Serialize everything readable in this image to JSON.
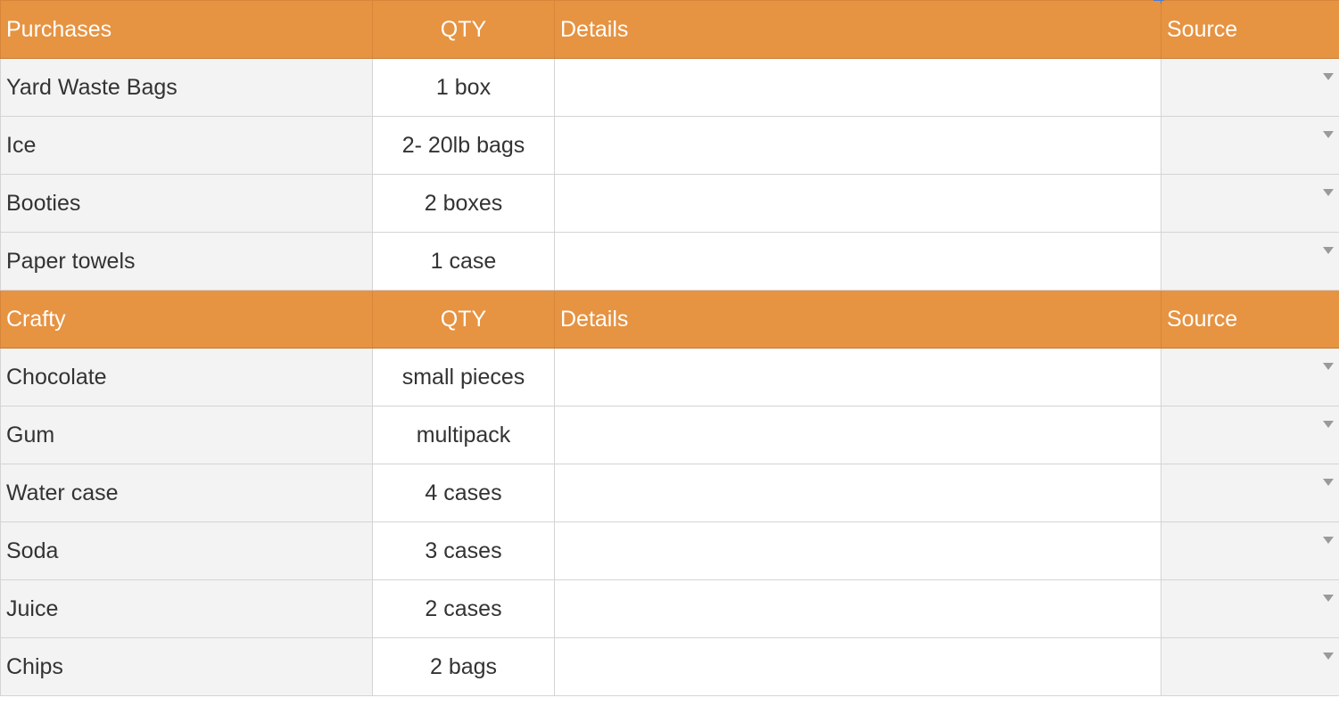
{
  "sections": [
    {
      "header": {
        "item": "Purchases",
        "qty": "QTY",
        "details": "Details",
        "source": "Source"
      },
      "rows": [
        {
          "item": "Yard Waste Bags",
          "qty": "1 box",
          "details": "",
          "source": ""
        },
        {
          "item": "Ice",
          "qty": "2- 20lb bags",
          "details": "",
          "source": ""
        },
        {
          "item": "Booties",
          "qty": "2 boxes",
          "details": "",
          "source": ""
        },
        {
          "item": "Paper towels",
          "qty": "1 case",
          "details": "",
          "source": ""
        }
      ]
    },
    {
      "header": {
        "item": "Crafty",
        "qty": "QTY",
        "details": "Details",
        "source": "Source"
      },
      "rows": [
        {
          "item": "Chocolate",
          "qty": "small pieces",
          "details": "",
          "source": ""
        },
        {
          "item": "Gum",
          "qty": "multipack",
          "details": "",
          "source": ""
        },
        {
          "item": "Water case",
          "qty": "4 cases",
          "details": "",
          "source": ""
        },
        {
          "item": "Soda",
          "qty": "3 cases",
          "details": "",
          "source": ""
        },
        {
          "item": "Juice",
          "qty": "2 cases",
          "details": "",
          "source": ""
        },
        {
          "item": "Chips",
          "qty": "2 bags",
          "details": "",
          "source": ""
        }
      ]
    }
  ],
  "colors": {
    "header_bg": "#e69342",
    "header_text": "#ffffff",
    "cell_gray": "#f3f3f3",
    "cell_white": "#ffffff",
    "grid_line": "#d4d4d4"
  },
  "icons": {
    "source_dropdown": "chevron-down-icon"
  }
}
